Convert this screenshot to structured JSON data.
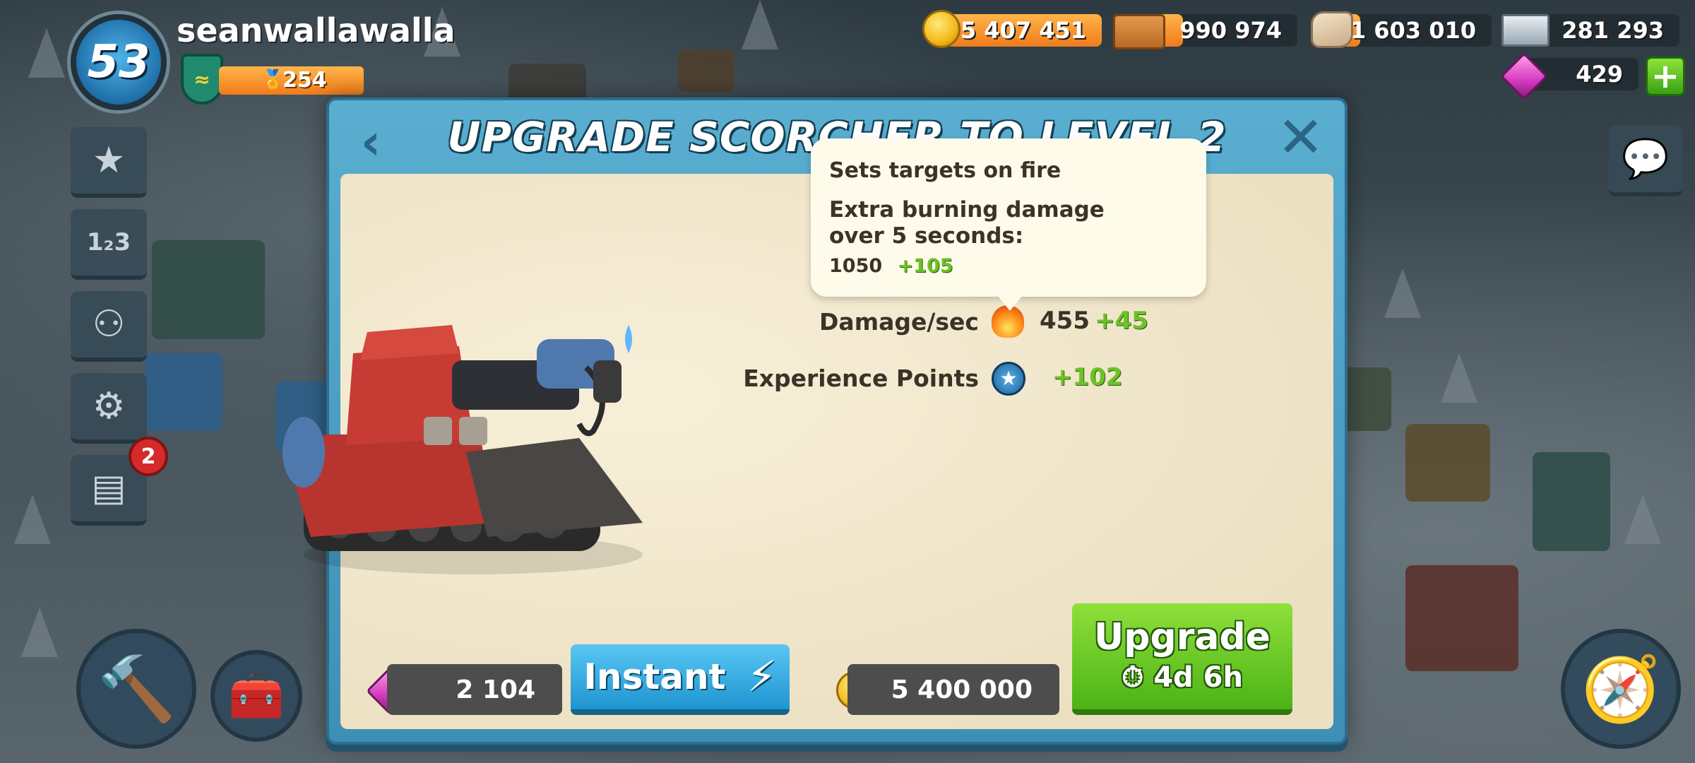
{
  "player": {
    "level": "53",
    "username": "seanwallawalla",
    "rank_points": "254"
  },
  "resources": {
    "gold": "5 407 451",
    "wood": "990 974",
    "stone": "1 603 010",
    "iron": "281 293",
    "diamonds": "429"
  },
  "side_menu": {
    "notification_count": "2"
  },
  "modal": {
    "title": "UPGRADE SCORCHER TO LEVEL 2",
    "back_glyph": "‹",
    "close_glyph": "✕",
    "stats": [
      {
        "label": "Damage/sec",
        "value": "455",
        "plus": "+45",
        "icon": "fire-icon"
      },
      {
        "label": "Experience Points",
        "value": "",
        "plus": "+102",
        "icon": "xp-star-icon"
      }
    ],
    "tooltip": {
      "title": "Sets targets on fire",
      "description": "Extra burning damage over 5 seconds:",
      "value": "1050",
      "plus": "+105"
    },
    "instant": {
      "cost": "2 104",
      "label": "Instant"
    },
    "upgrade": {
      "cost": "5 400 000",
      "label": "Upgrade",
      "time": "4d 6h"
    }
  },
  "colors": {
    "modal_blue": "#4fa6cc",
    "parchment": "#efe6cc",
    "upgrade_green": "#5cc11f",
    "instant_blue": "#2ea3dc",
    "plus_green": "#6cc226",
    "resource_orange": "#f59a2e"
  }
}
